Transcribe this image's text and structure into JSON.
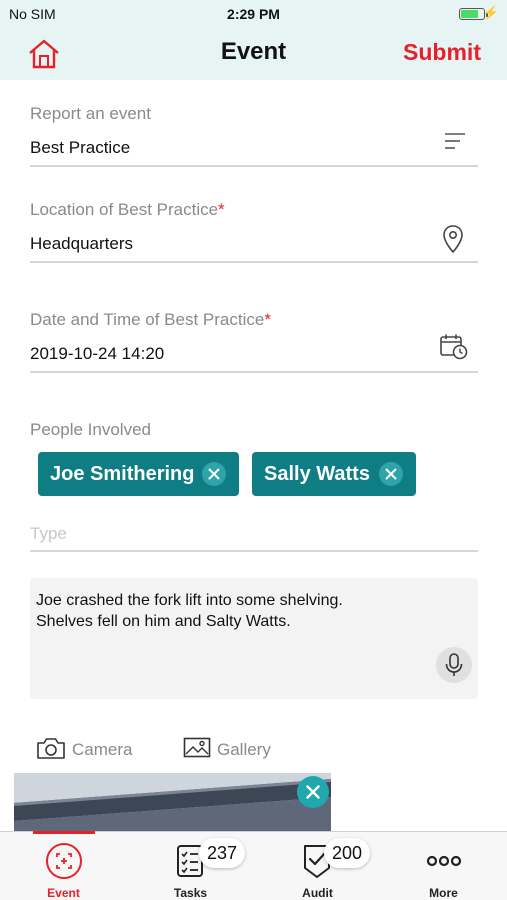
{
  "status_bar": {
    "carrier": "No SIM",
    "time": "2:29 PM",
    "battery_level": 0.75
  },
  "nav": {
    "title": "Event",
    "submit_label": "Submit",
    "home_icon": "home-icon"
  },
  "form": {
    "report": {
      "label": "Report an event",
      "value": "Best Practice",
      "icon": "filter-lines-icon"
    },
    "location": {
      "label": "Location of Best Practice",
      "required_mark": "*",
      "value": "Headquarters",
      "icon": "location-pin-icon"
    },
    "datetime": {
      "label": "Date and Time of Best Practice",
      "required_mark": "*",
      "value": "2019-10-24 14:20",
      "icon": "calendar-clock-icon"
    },
    "people": {
      "label": "People Involved",
      "chips": [
        {
          "name": "Joe Smithering"
        },
        {
          "name": "Sally Watts"
        }
      ],
      "type_placeholder": "Type"
    },
    "notes": {
      "text": "Joe crashed the fork lift into some shelving.\nShelves fell on him and Salty Watts.",
      "mic_icon": "microphone-icon"
    },
    "media": {
      "camera_label": "Camera",
      "gallery_label": "Gallery"
    }
  },
  "tabs": [
    {
      "label": "Event",
      "icon": "event-scan-icon",
      "active": true
    },
    {
      "label": "Tasks",
      "icon": "tasks-list-icon",
      "badge": "237"
    },
    {
      "label": "Audit",
      "icon": "audit-shield-icon",
      "badge": "200"
    },
    {
      "label": "More",
      "icon": "more-dots-icon"
    }
  ],
  "colors": {
    "header_bg": "#e6f4f4",
    "accent_red": "#e8202a",
    "chip_teal": "#0f7e84",
    "chip_x_teal": "#2ea4a8"
  }
}
